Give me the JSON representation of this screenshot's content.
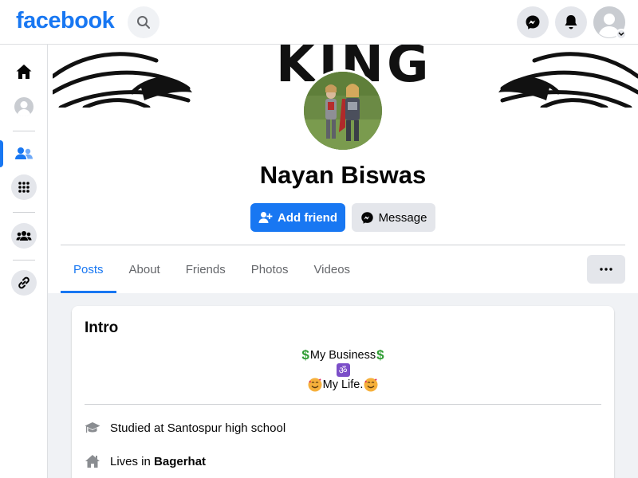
{
  "topbar": {
    "logo": "facebook"
  },
  "profile": {
    "cover_text": "KING",
    "name": "Nayan Biswas",
    "add_friend_label": "Add friend",
    "message_label": "Message"
  },
  "tabs": [
    "Posts",
    "About",
    "Friends",
    "Photos",
    "Videos"
  ],
  "more_label": "···",
  "intro": {
    "title": "Intro",
    "bio_line1_text": "My Business",
    "bio_dollar": "$",
    "bio_line2": "ॐ",
    "bio_line3_text": " My Life.",
    "education_text": "Studied at Santospur high school",
    "lives_prefix": "Lives in ",
    "lives_place": "Bagerhat"
  },
  "colors": {
    "brand": "#1877f2",
    "bg": "#f0f2f5"
  }
}
